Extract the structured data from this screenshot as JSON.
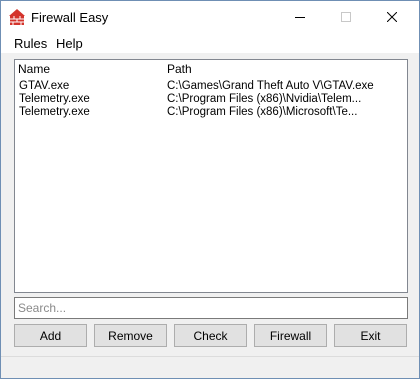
{
  "window": {
    "title": "Firewall Easy",
    "minimize_icon": "minimize-icon",
    "maximize_icon": "maximize-icon",
    "close_icon": "close-icon",
    "app_icon": "firewall-brick-icon",
    "accent_color": "#d4342c"
  },
  "menu": {
    "items": [
      {
        "label": "Rules"
      },
      {
        "label": "Help"
      }
    ]
  },
  "list": {
    "columns": [
      "Name",
      "Path"
    ],
    "rows": [
      {
        "name": "GTAV.exe",
        "path": "C:\\Games\\Grand Theft Auto V\\GTAV.exe"
      },
      {
        "name": "Telemetry.exe",
        "path": "C:\\Program Files (x86)\\Nvidia\\Telem..."
      },
      {
        "name": "Telemetry.exe",
        "path": "C:\\Program Files (x86)\\Microsoft\\Te..."
      }
    ]
  },
  "search": {
    "placeholder": "Search...",
    "value": ""
  },
  "buttons": {
    "add": "Add",
    "remove": "Remove",
    "check": "Check",
    "firewall": "Firewall",
    "exit": "Exit"
  }
}
